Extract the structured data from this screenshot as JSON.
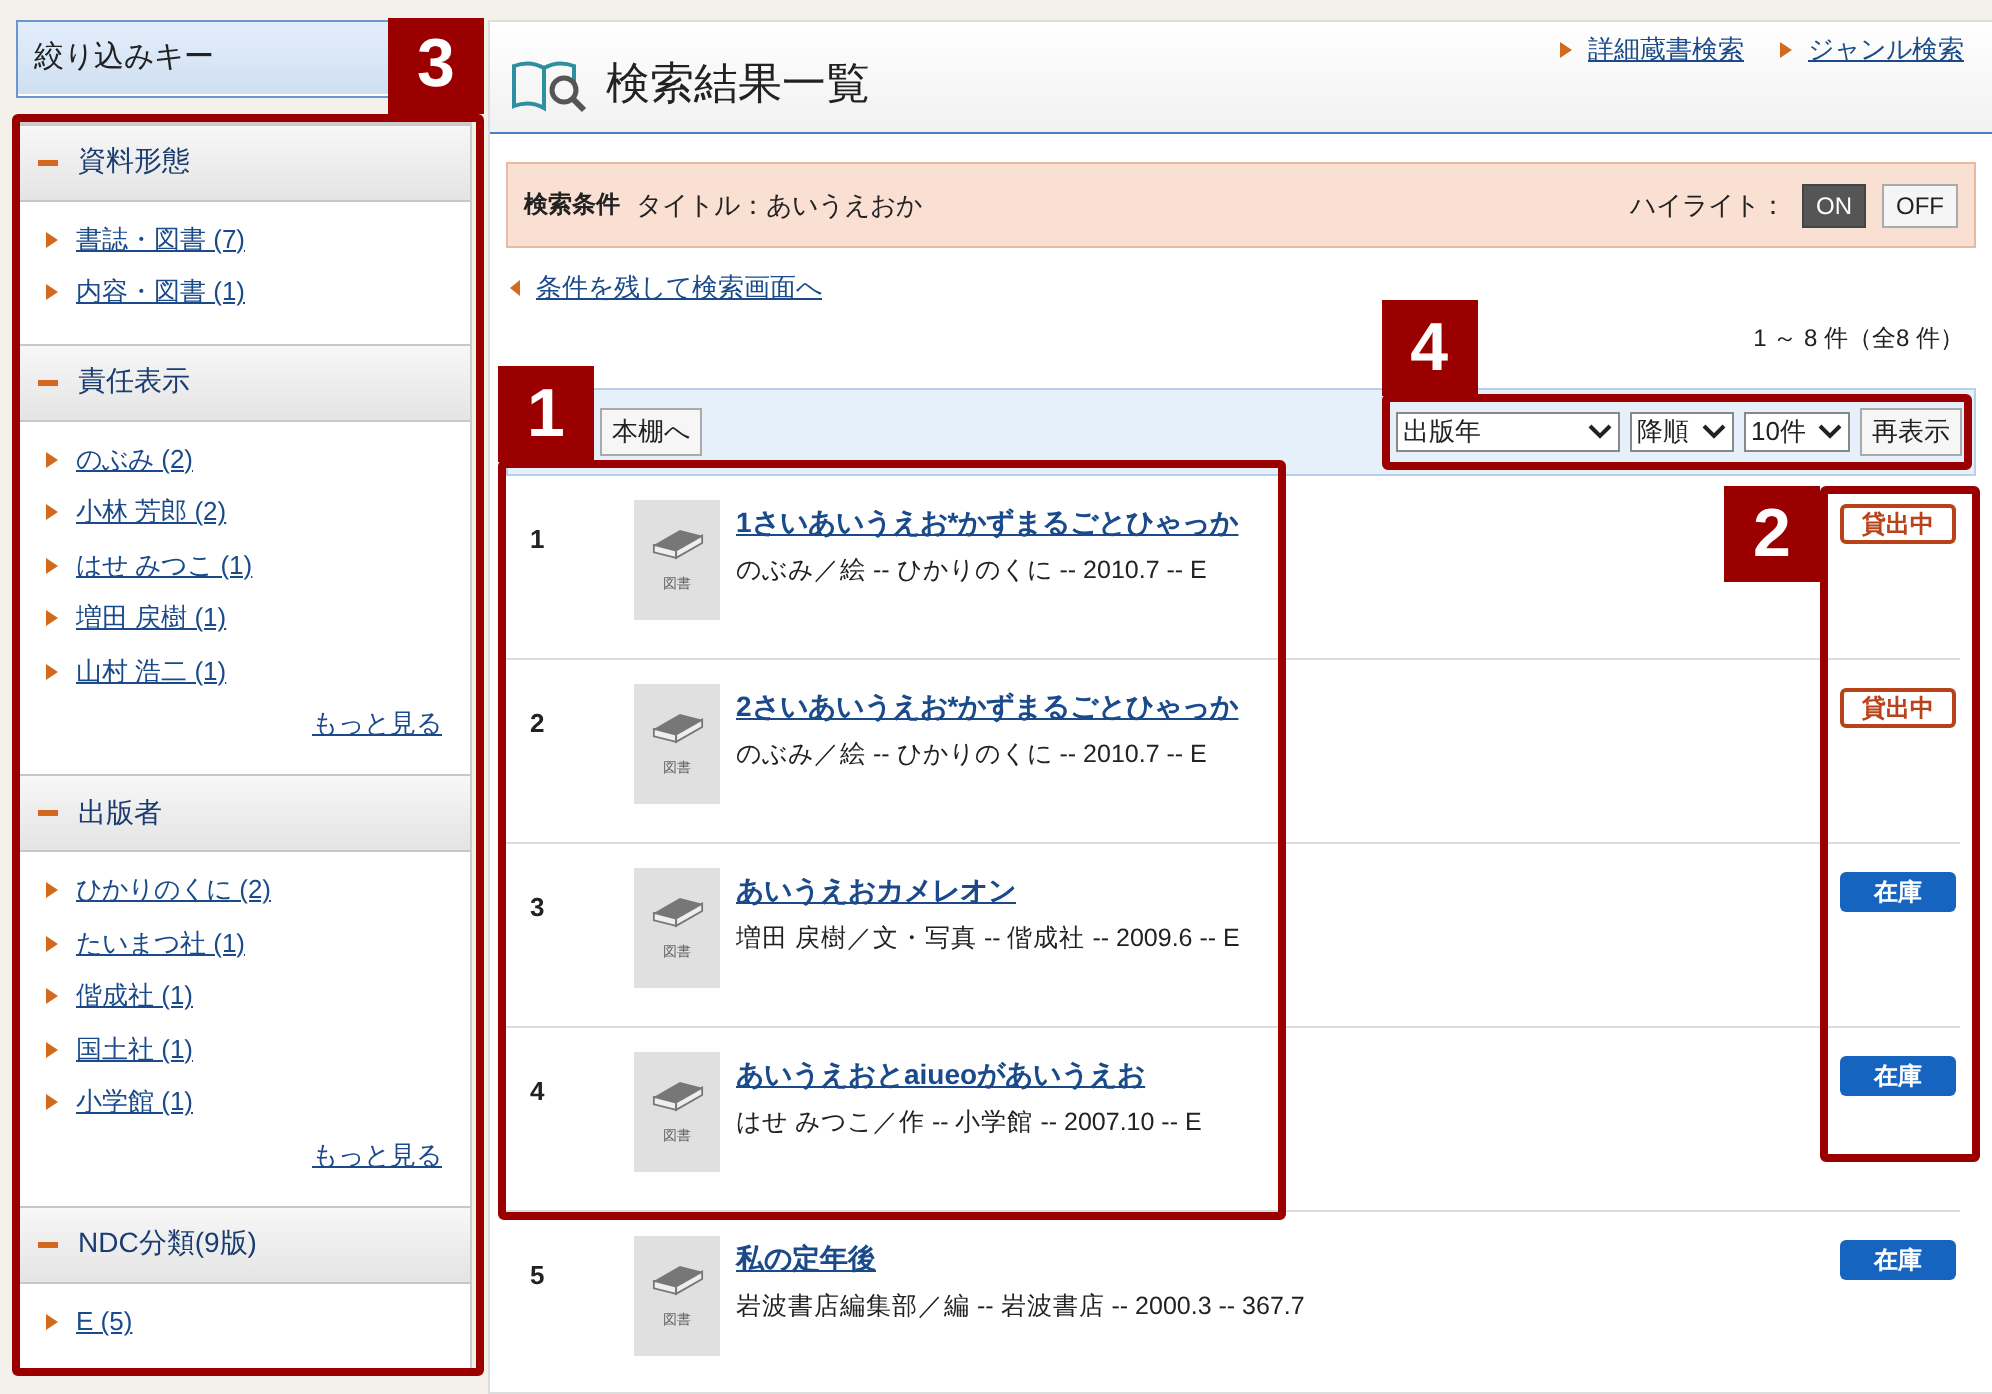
{
  "sidebar": {
    "title": "絞り込みキー",
    "sections": [
      {
        "heading": "資料形態",
        "expanded": true,
        "items": [
          "書誌・図書 (7)",
          "内容・図書 (1)"
        ]
      },
      {
        "heading": "責任表示",
        "expanded": true,
        "items": [
          "のぶみ (2)",
          "小林 芳郎 (2)",
          "はせ みつこ (1)",
          "増田 戻樹 (1)",
          "山村 浩二 (1)"
        ],
        "more": "もっと見る"
      },
      {
        "heading": "出版者",
        "expanded": true,
        "items": [
          "ひかりのくに (2)",
          "たいまつ社 (1)",
          "偕成社 (1)",
          "国土社 (1)",
          "小学館 (1)"
        ],
        "more": "もっと見る"
      },
      {
        "heading": "NDC分類(9版)",
        "expanded": true,
        "items": [
          "E (5)"
        ]
      }
    ]
  },
  "header": {
    "title": "検索結果一覧",
    "links": [
      "詳細蔵書検索",
      "ジャンル検索"
    ]
  },
  "conditions": {
    "label": "検索条件",
    "text": "タイトル：あいうえおか",
    "highlight_label": "ハイライト：",
    "toggle": [
      {
        "label": "ON",
        "selected": true
      },
      {
        "label": "OFF",
        "selected": false
      }
    ]
  },
  "back_link": "条件を残して検索画面へ",
  "count": "1 ～ 8 件（全8 件）",
  "toolbar": {
    "bookshelf_button": "本棚へ",
    "sort_field": "出版年",
    "sort_order": "降順",
    "per_page": "10件",
    "refresh_button": "再表示"
  },
  "results": [
    {
      "number": "1",
      "thumb_label": "図書",
      "title": "1さいあいうえお*かずまるごとひゃっか",
      "meta": "のぶみ／絵 -- ひかりのくに -- 2010.7 -- E",
      "status": {
        "kind": "on_loan",
        "label": "貸出中"
      }
    },
    {
      "number": "2",
      "thumb_label": "図書",
      "title": "2さいあいうえお*かずまるごとひゃっか",
      "meta": "のぶみ／絵 -- ひかりのくに -- 2010.7 -- E",
      "status": {
        "kind": "on_loan",
        "label": "貸出中"
      }
    },
    {
      "number": "3",
      "thumb_label": "図書",
      "title": "あいうえおカメレオン",
      "meta": "増田 戻樹／文・写真 -- 偕成社 -- 2009.6 -- E",
      "status": {
        "kind": "in_stock",
        "label": "在庫"
      }
    },
    {
      "number": "4",
      "thumb_label": "図書",
      "title": "あいうえおとaiueoがあいうえお",
      "meta": "はせ みつこ／作 -- 小学館 -- 2007.10 -- E",
      "status": {
        "kind": "in_stock",
        "label": "在庫"
      }
    },
    {
      "number": "5",
      "thumb_label": "図書",
      "title": "私の定年後",
      "meta": "岩波書店編集部／編 -- 岩波書店 -- 2000.3 -- 367.7",
      "status": {
        "kind": "in_stock",
        "label": "在庫"
      }
    }
  ],
  "callouts": [
    "3",
    "1",
    "4",
    "2"
  ]
}
